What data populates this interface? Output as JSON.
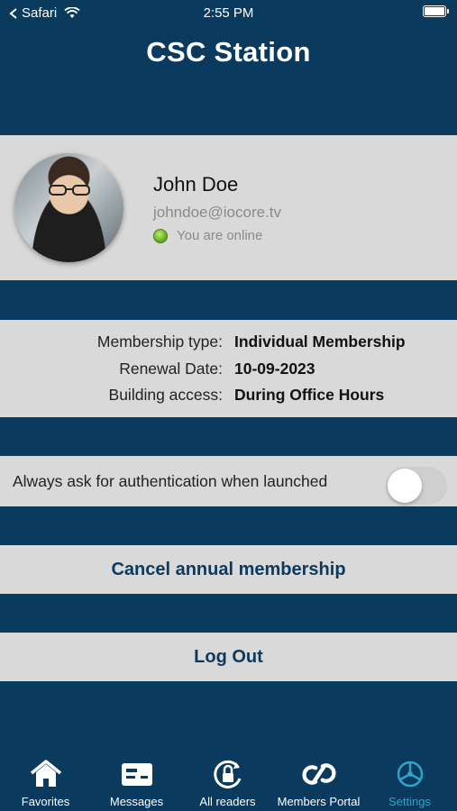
{
  "status": {
    "back_app": "Safari",
    "time": "2:55 PM"
  },
  "header": {
    "title": "CSC Station"
  },
  "profile": {
    "name": "John Doe",
    "email": "johndoe@iocore.tv",
    "status_text": "You are online",
    "status_color": "#5aa420"
  },
  "membership": {
    "rows": [
      {
        "label": "Membership type:",
        "value": "Individual Membership"
      },
      {
        "label": "Renewal Date:",
        "value": "10-09-2023"
      },
      {
        "label": "Building access:",
        "value": "During Office Hours"
      }
    ]
  },
  "auth": {
    "label": "Always ask for authentication when launched",
    "toggle_on": false
  },
  "actions": {
    "cancel_label": "Cancel annual membership",
    "logout_label": "Log Out"
  },
  "tabbar": {
    "items": [
      {
        "label": "Favorites",
        "icon": "house-icon",
        "active": false
      },
      {
        "label": "Messages",
        "icon": "message-card-icon",
        "active": false
      },
      {
        "label": "All readers",
        "icon": "reader-lock-icon",
        "active": false
      },
      {
        "label": "Members Portal",
        "icon": "portal-link-icon",
        "active": false
      },
      {
        "label": "Settings",
        "icon": "settings-icon",
        "active": true
      }
    ]
  },
  "colors": {
    "background": "#0a3a5e",
    "panel": "#d9d9d9",
    "accent": "#2ea4c8",
    "action_text": "#0b3a5e"
  }
}
